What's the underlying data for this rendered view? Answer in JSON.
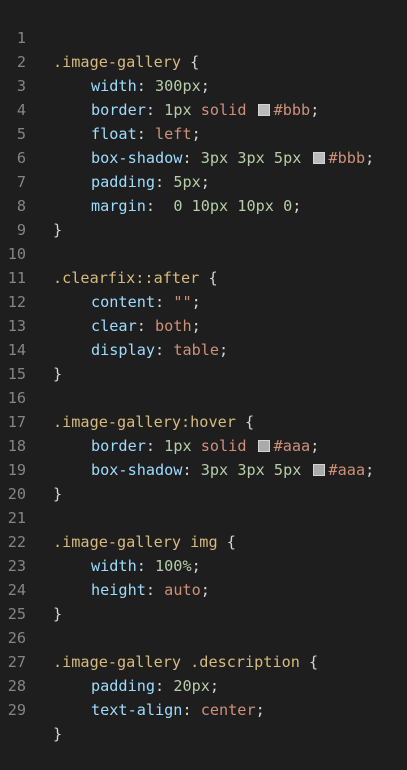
{
  "editor": {
    "line_numbers": [
      "1",
      "2",
      "3",
      "4",
      "5",
      "6",
      "7",
      "8",
      "9",
      "10",
      "11",
      "12",
      "13",
      "14",
      "15",
      "16",
      "17",
      "18",
      "19",
      "20",
      "21",
      "22",
      "23",
      "24",
      "25",
      "26",
      "27",
      "28",
      "29"
    ],
    "lines": {
      "l1": {
        "selector": ".image-gallery",
        "open": " {"
      },
      "l2": {
        "prop": "width",
        "colon": ": ",
        "value": "300px",
        "semi": ";"
      },
      "l3": {
        "prop": "border",
        "colon": ": ",
        "v1": "1px",
        "v2": " solid ",
        "color": "#bbb",
        "semi": ";"
      },
      "l4": {
        "prop": "float",
        "colon": ": ",
        "value": "left",
        "semi": ";"
      },
      "l5": {
        "prop": "box-shadow",
        "colon": ": ",
        "v1": "3px",
        "v2": "3px",
        "v3": "5px",
        "color": "#bbb",
        "semi": ";"
      },
      "l6": {
        "prop": "padding",
        "colon": ": ",
        "value": "5px",
        "semi": ";"
      },
      "l7": {
        "prop": "margin",
        "colon": ":  ",
        "v1": "0",
        "v2": "10px",
        "v3": "10px",
        "v4": "0",
        "semi": ";"
      },
      "l8": {
        "close": "}"
      },
      "l10": {
        "selector": ".clearfix::after",
        "open": " {"
      },
      "l11": {
        "prop": "content",
        "colon": ": ",
        "value": "\"\"",
        "semi": ";"
      },
      "l12": {
        "prop": "clear",
        "colon": ": ",
        "value": "both",
        "semi": ";"
      },
      "l13": {
        "prop": "display",
        "colon": ": ",
        "value": "table",
        "semi": ";"
      },
      "l14": {
        "close": "}"
      },
      "l16": {
        "selector": ".image-gallery:hover",
        "open": " {"
      },
      "l17": {
        "prop": "border",
        "colon": ": ",
        "v1": "1px",
        "v2": " solid ",
        "color": "#aaa",
        "semi": ";"
      },
      "l18": {
        "prop": "box-shadow",
        "colon": ": ",
        "v1": "3px",
        "v2": "3px",
        "v3": "5px",
        "color": "#aaa",
        "semi": ";"
      },
      "l19": {
        "close": "}"
      },
      "l21": {
        "selector": ".image-gallery img",
        "open": " {"
      },
      "l22": {
        "prop": "width",
        "colon": ": ",
        "value": "100%",
        "semi": ";"
      },
      "l23": {
        "prop": "height",
        "colon": ": ",
        "value": "auto",
        "semi": ";"
      },
      "l24": {
        "close": "}"
      },
      "l26": {
        "selector": ".image-gallery .description",
        "open": " {"
      },
      "l27": {
        "prop": "padding",
        "colon": ": ",
        "value": "20px",
        "semi": ";"
      },
      "l28": {
        "prop": "text-align",
        "colon": ": ",
        "value": "center",
        "semi": ";"
      },
      "l29": {
        "close": "}"
      }
    },
    "colors": {
      "background": "#1e1e1e",
      "gutter": "#858585",
      "selector": "#d7ba7d",
      "property": "#9cdcfe",
      "number": "#b5cea8",
      "value": "#ce9178",
      "punctuation": "#d4d4d4",
      "swatch_bbb": "#bbbbbb",
      "swatch_aaa": "#aaaaaa"
    }
  }
}
